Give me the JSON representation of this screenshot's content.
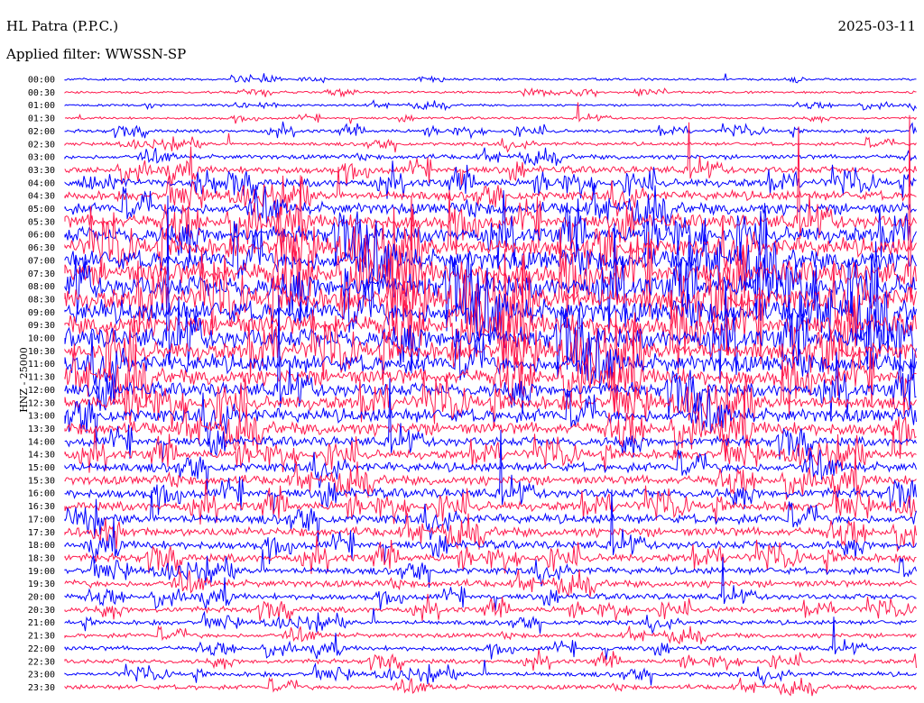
{
  "header": {
    "station": "HL Patra (P.P.C.)",
    "date": "2025-03-11",
    "filter": "Applied filter: WWSSN-SP"
  },
  "chart_data": {
    "type": "line",
    "title": "HL Patra (P.P.C.)",
    "ylabel": "HNZ - 25000",
    "xlabel": "",
    "rows": [
      "00:00",
      "00:30",
      "01:00",
      "01:30",
      "02:00",
      "02:30",
      "03:00",
      "03:30",
      "04:00",
      "04:30",
      "05:00",
      "05:30",
      "06:00",
      "06:30",
      "07:00",
      "07:30",
      "08:00",
      "08:30",
      "09:00",
      "09:30",
      "10:00",
      "10:30",
      "11:00",
      "11:30",
      "12:00",
      "12:30",
      "13:00",
      "13:30",
      "14:00",
      "14:30",
      "15:00",
      "15:30",
      "16:00",
      "16:30",
      "17:00",
      "17:30",
      "18:00",
      "18:30",
      "19:00",
      "19:30",
      "20:00",
      "20:30",
      "21:00",
      "21:30",
      "22:00",
      "22:30",
      "23:00",
      "23:30"
    ],
    "series_colors": [
      "#0000ff",
      "#ff1a4d"
    ],
    "noise_level": [
      1,
      1,
      1,
      1,
      1.5,
      1.5,
      2,
      3,
      3.5,
      4,
      5,
      6,
      7,
      8,
      9,
      10,
      10,
      10,
      10,
      9,
      9,
      8,
      8,
      7,
      6,
      6,
      6,
      5.5,
      4,
      4,
      4,
      4,
      4,
      4,
      4,
      4,
      3.5,
      3.5,
      3,
      3,
      2.5,
      2.5,
      2,
      2,
      2,
      2,
      2,
      2
    ]
  }
}
